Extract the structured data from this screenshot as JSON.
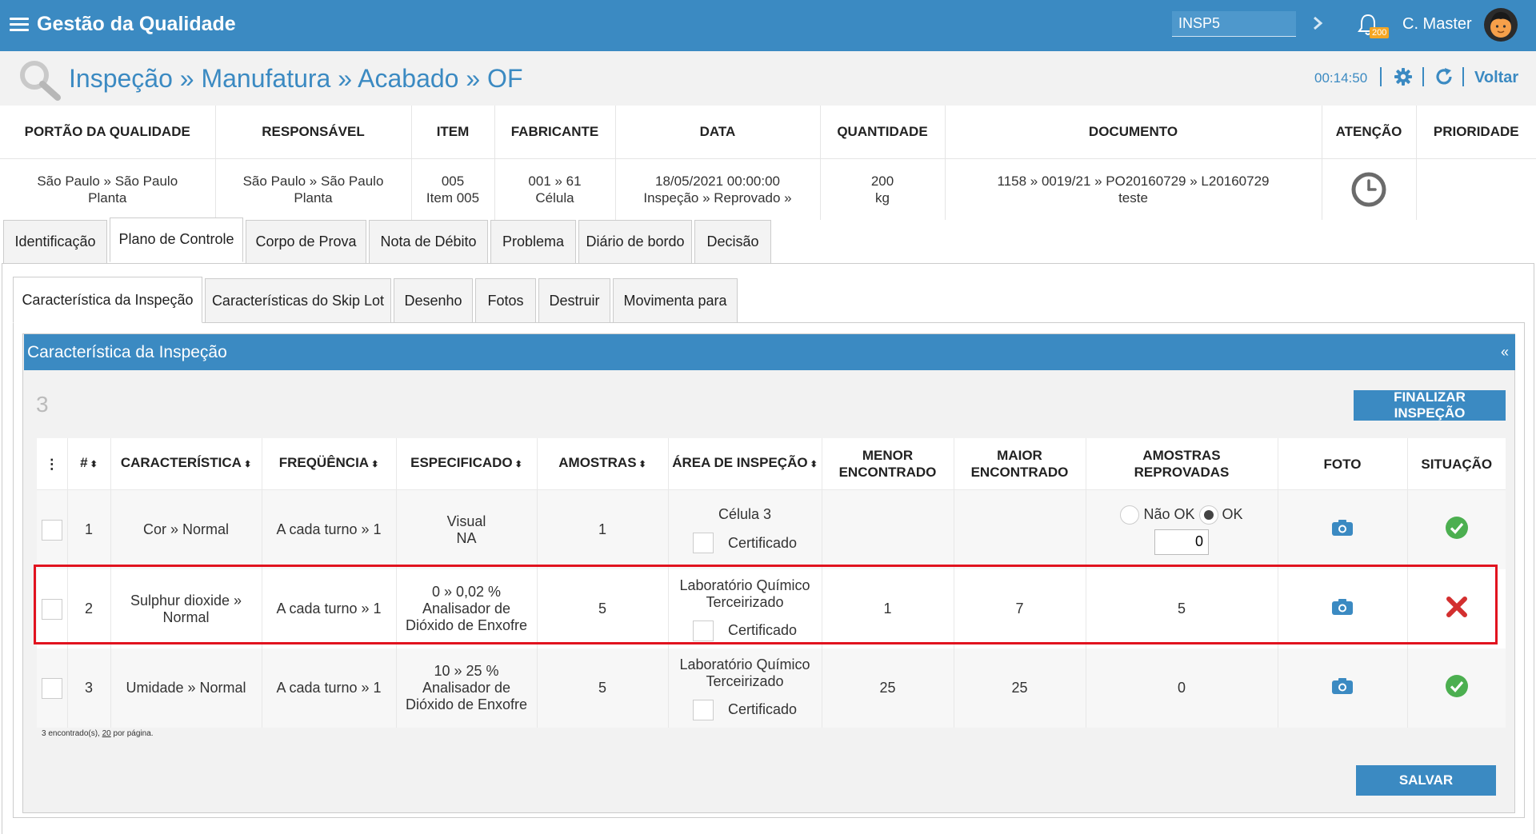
{
  "app": {
    "title": "Gestão da Qualidade",
    "search_value": "INSP5",
    "notif_count": "200",
    "user": "C. Master"
  },
  "header": {
    "breadcrumb": "Inspeção » Manufatura » Acabado » OF",
    "timer": "00:14:50",
    "back_label": "Voltar"
  },
  "info": {
    "columns": [
      "PORTÃO DA QUALIDADE",
      "RESPONSÁVEL",
      "ITEM",
      "FABRICANTE",
      "DATA",
      "QUANTIDADE",
      "DOCUMENTO",
      "ATENÇÃO",
      "PRIORIDADE"
    ],
    "values": {
      "portao": [
        "São Paulo » São Paulo",
        "Planta"
      ],
      "responsavel": [
        "São Paulo » São Paulo",
        "Planta"
      ],
      "item": [
        "005",
        "Item 005"
      ],
      "fabricante": [
        "001 » 61",
        "Célula"
      ],
      "data": [
        "18/05/2021 00:00:00",
        "Inspeção » Reprovado »"
      ],
      "quantidade": [
        "200",
        "kg"
      ],
      "documento": [
        "1158 » 0019/21 » PO20160729 » L20160729",
        "teste"
      ]
    },
    "attention_icon": "clock-icon"
  },
  "tabs_main": [
    "Identificação",
    "Plano de Controle",
    "Corpo de Prova",
    "Nota de Débito",
    "Problema",
    "Diário de bordo",
    "Decisão"
  ],
  "tabs_sub": [
    "Característica da Inspeção",
    "Características do Skip Lot",
    "Desenho",
    "Fotos",
    "Destruir",
    "Movimenta para"
  ],
  "section": {
    "title": "Característica da Inspeção",
    "collapse": "«",
    "count": "3",
    "finalize_label": "FINALIZAR INSPEÇÃO",
    "save_label": "SALVAR",
    "footer": {
      "found": "3 encontrado(s), ",
      "per_page": "20",
      "per_page_suffix": " por página."
    }
  },
  "grid": {
    "headers": {
      "menu": "⋮",
      "num": "#",
      "caracteristica": "CARACTERÍSTICA",
      "frequencia": "FREQÜÊNCIA",
      "especificado": "ESPECIFICADO",
      "amostras": "AMOSTRAS",
      "area": "ÁREA DE INSPEÇÃO",
      "menor": [
        "MENOR",
        "ENCONTRADO"
      ],
      "maior": [
        "MAIOR",
        "ENCONTRADO"
      ],
      "reprovadas": [
        "AMOSTRAS",
        "REPROVADAS"
      ],
      "foto": "FOTO",
      "situacao": "SITUAÇÃO",
      "sort_glyph": "⬍"
    },
    "rows": [
      {
        "num": "1",
        "caracteristica": "Cor » Normal",
        "frequencia": "A cada turno » 1",
        "especificado": [
          "Visual",
          "NA"
        ],
        "amostras": "1",
        "area": [
          "Célula 3"
        ],
        "certificado": "Certificado",
        "menor": "",
        "maior": "",
        "reprovadas_radio": {
          "nao_ok": "Não OK",
          "ok": "OK",
          "selected": "ok",
          "value": "0"
        },
        "situacao": "ok"
      },
      {
        "num": "2",
        "caracteristica": [
          "Sulphur dioxide »",
          "Normal"
        ],
        "frequencia": "A cada turno » 1",
        "especificado": [
          "0 » 0,02 %",
          "Analisador de",
          "Dióxido de Enxofre"
        ],
        "amostras": "5",
        "area": [
          "Laboratório Químico",
          "Terceirizado"
        ],
        "certificado": "Certificado",
        "menor": "1",
        "maior": "7",
        "reprovadas": "5",
        "situacao": "fail"
      },
      {
        "num": "3",
        "caracteristica": "Umidade » Normal",
        "frequencia": "A cada turno » 1",
        "especificado": [
          "10 » 25 %",
          "Analisador de",
          "Dióxido de Enxofre"
        ],
        "amostras": "5",
        "area": [
          "Laboratório Químico",
          "Terceirizado"
        ],
        "certificado": "Certificado",
        "menor": "25",
        "maior": "25",
        "reprovadas": "0",
        "situacao": "ok"
      }
    ]
  },
  "colors": {
    "primary": "#3b8ac2",
    "ok": "#4caf50",
    "fail": "#d32f2f",
    "highlight": "#e1131f"
  }
}
